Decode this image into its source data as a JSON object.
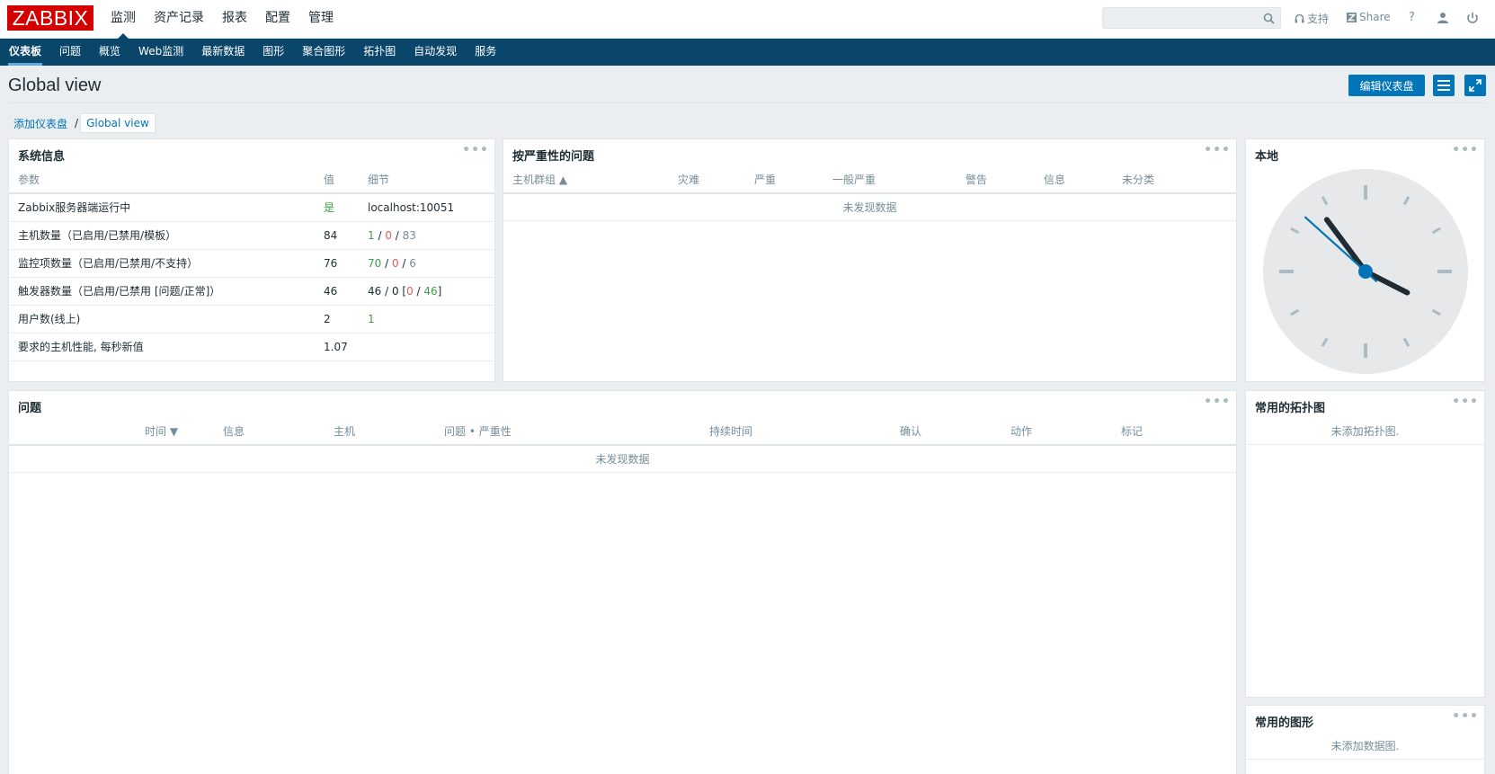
{
  "header": {
    "logo": "ZABBIX",
    "menu": [
      "监测",
      "资产记录",
      "报表",
      "配置",
      "管理"
    ],
    "support": "支持",
    "share": "Share",
    "help": "?",
    "search_value": ""
  },
  "subnav": [
    "仪表板",
    "问题",
    "概览",
    "Web监测",
    "最新数据",
    "图形",
    "聚合图形",
    "拓扑图",
    "自动发现",
    "服务"
  ],
  "page": {
    "title": "Global view",
    "edit_button": "编辑仪表盘",
    "breadcrumb": [
      "添加仪表盘",
      "Global view"
    ],
    "breadcrumb_sep": "/"
  },
  "sysinfo": {
    "title": "系统信息",
    "columns": [
      "参数",
      "值",
      "细节"
    ],
    "rows": [
      {
        "param": "Zabbix服务器端运行中",
        "value": "是",
        "detail": "localhost:10051"
      },
      {
        "param": "主机数量（已启用/已禁用/模板）",
        "value": "84",
        "d1": "1",
        "d2": "0",
        "d3": "83"
      },
      {
        "param": "监控项数量（已启用/已禁用/不支持）",
        "value": "76",
        "d1": "70",
        "d2": "0",
        "d3": "6"
      },
      {
        "param": "触发器数量（已启用/已禁用 [问题/正常]）",
        "value": "46",
        "dpre": "46 / 0 [",
        "d1": "0",
        "d2": "46",
        "dpost": "]"
      },
      {
        "param": "用户数(线上)",
        "value": "2",
        "d1": "1"
      },
      {
        "param": "要求的主机性能, 每秒新值",
        "value": "1.07"
      }
    ]
  },
  "severity": {
    "title": "按严重性的问题",
    "columns": [
      "主机群组 ▲",
      "灾难",
      "严重",
      "一般严重",
      "警告",
      "信息",
      "未分类"
    ],
    "nodata": "未发现数据"
  },
  "clock": {
    "title": "本地",
    "hour": 3,
    "minute": 53,
    "second": 52
  },
  "problems": {
    "title": "问题",
    "columns": [
      "时间 ▼",
      "信息",
      "主机",
      "问题 • 严重性",
      "持续时间",
      "确认",
      "动作",
      "标记"
    ],
    "nodata": "未发现数据"
  },
  "maps": {
    "title": "常用的拓扑图",
    "empty": "未添加拓扑图."
  },
  "graphs": {
    "title": "常用的图形",
    "empty": "未添加数据图."
  },
  "colors": {
    "accent": "#0275b8",
    "nav": "#0a466a",
    "ok": "#429e47",
    "problem": "#e45959",
    "logo": "#d40000"
  }
}
